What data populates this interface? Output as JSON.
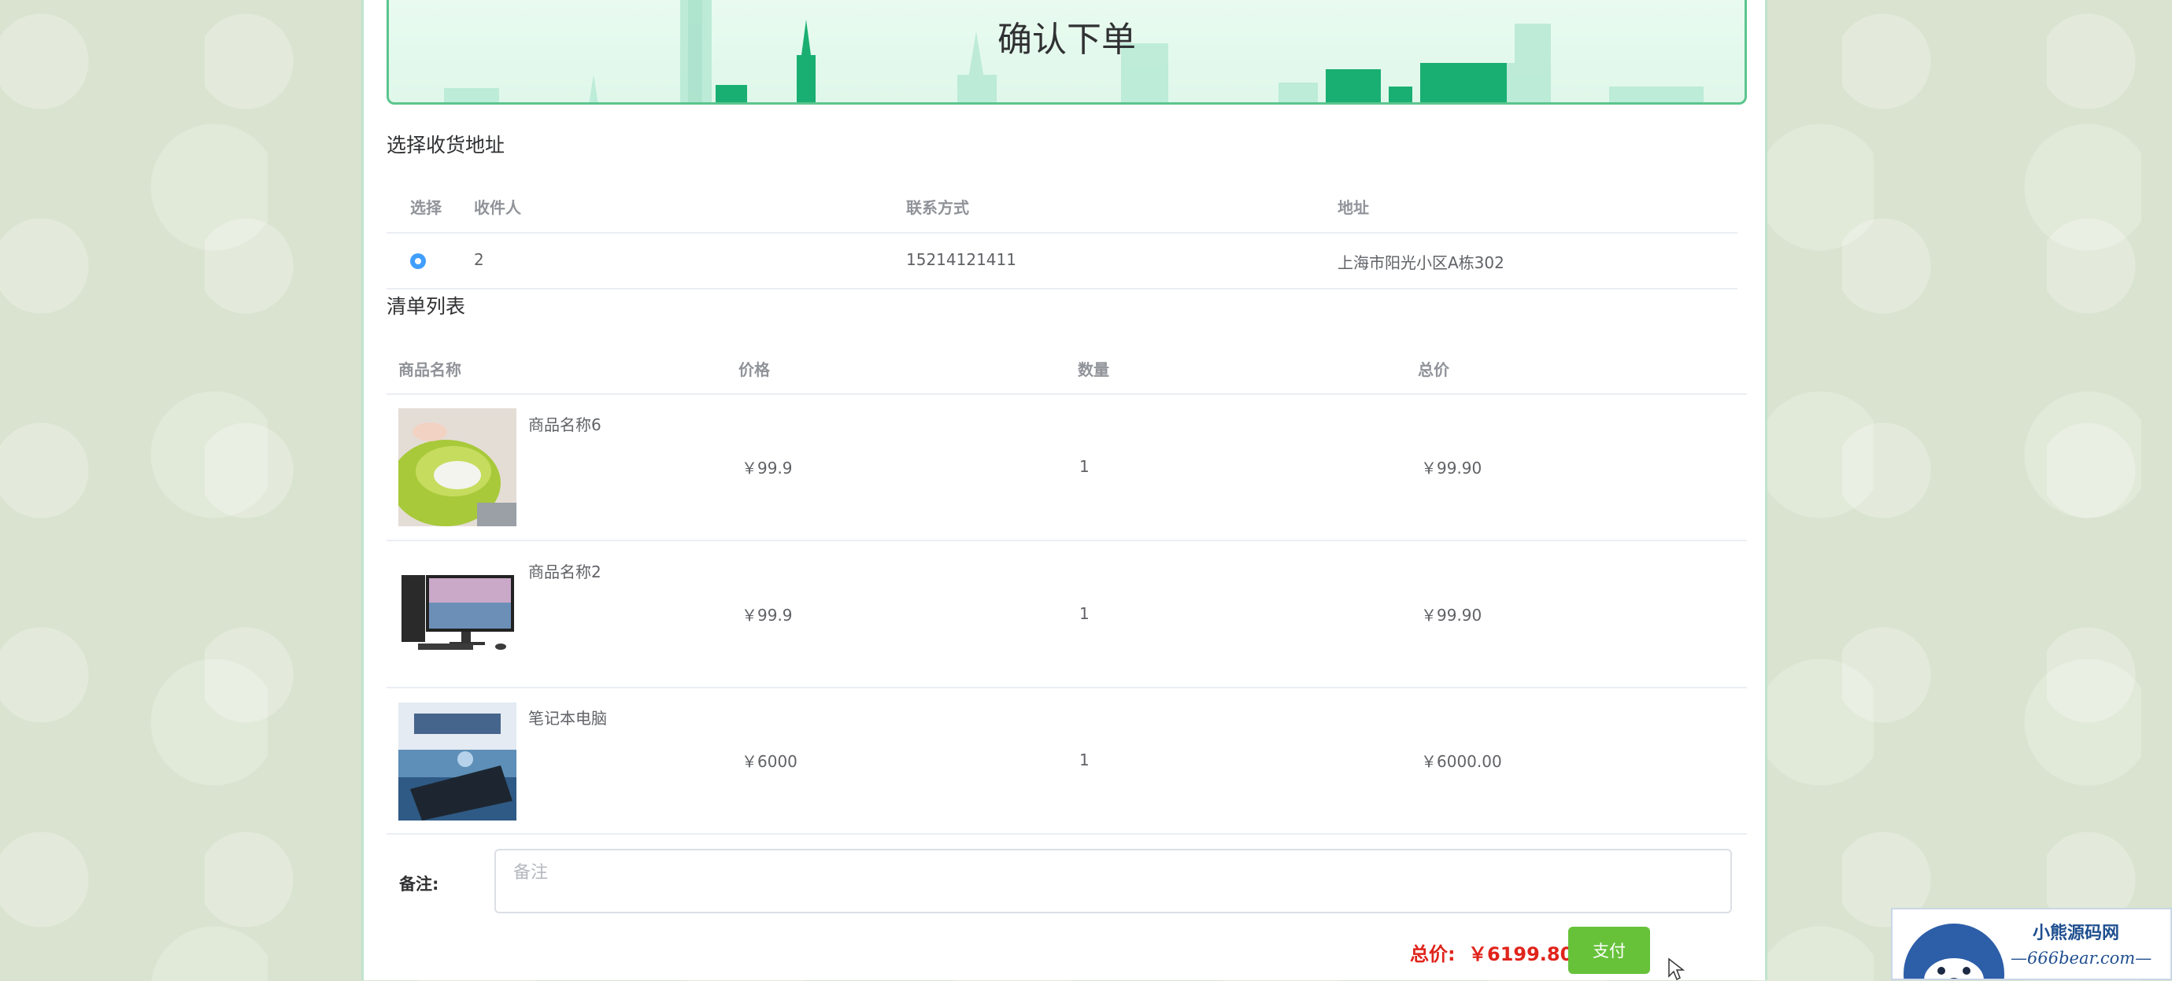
{
  "header": {
    "title": "确认下单"
  },
  "address": {
    "section_title": "选择收货地址",
    "columns": [
      "选择",
      "收件人",
      "联系方式",
      "地址"
    ],
    "rows": [
      {
        "selected": true,
        "recipient": "2",
        "phone": "15214121411",
        "address": "上海市阳光小区A栋302"
      }
    ]
  },
  "items": {
    "section_title": "清单列表",
    "columns": [
      "商品名称",
      "价格",
      "数量",
      "总价"
    ],
    "rows": [
      {
        "name": "商品名称6",
        "price": "￥99.9",
        "qty": "1",
        "subtotal": "￥99.90",
        "image": "green-colander-photo"
      },
      {
        "name": "商品名称2",
        "price": "￥99.9",
        "qty": "1",
        "subtotal": "￥99.90",
        "image": "desktop-computer-photo"
      },
      {
        "name": "笔记本电脑",
        "price": "￥6000",
        "qty": "1",
        "subtotal": "￥6000.00",
        "image": "laptop-photo"
      }
    ]
  },
  "remark": {
    "label": "备注:",
    "placeholder": "备注",
    "value": ""
  },
  "footer": {
    "total_label": "总价:",
    "total_value": "￥6199.80",
    "pay_label": "支付"
  },
  "watermark": {
    "title": "小熊源码网",
    "url": "—666bear.com—"
  },
  "colors": {
    "accent_green": "#5bc58e",
    "pay_button": "#67c23a",
    "total_red": "#e0241b",
    "radio_blue": "#409eff"
  }
}
